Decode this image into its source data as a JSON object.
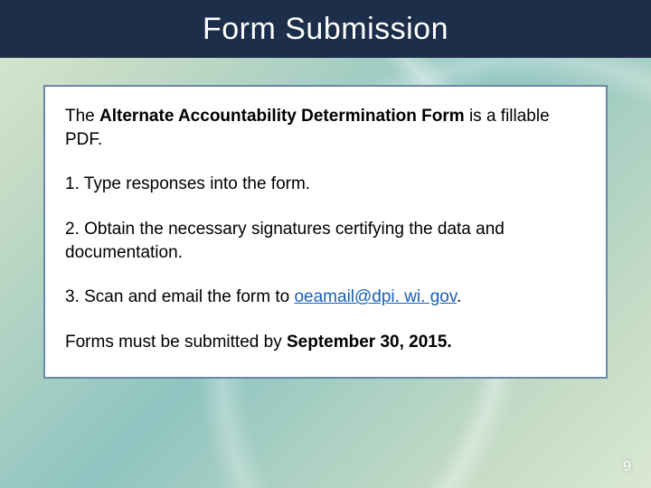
{
  "title": "Form Submission",
  "intro_pre": "The ",
  "intro_bold": "Alternate Accountability Determination Form",
  "intro_post": " is a fillable PDF.",
  "step1": "1. Type responses into the form.",
  "step2": "2. Obtain the necessary signatures certifying the data and documentation.",
  "step3_pre": "3. Scan and email the form to ",
  "step3_email": "oeamail@dpi. wi. gov",
  "step3_post": ".",
  "email_href": "mailto:oeamail@dpi.wi.gov",
  "closing_pre": "Forms must be submitted by ",
  "closing_bold": "September 30, 2015.",
  "page_number": "9"
}
